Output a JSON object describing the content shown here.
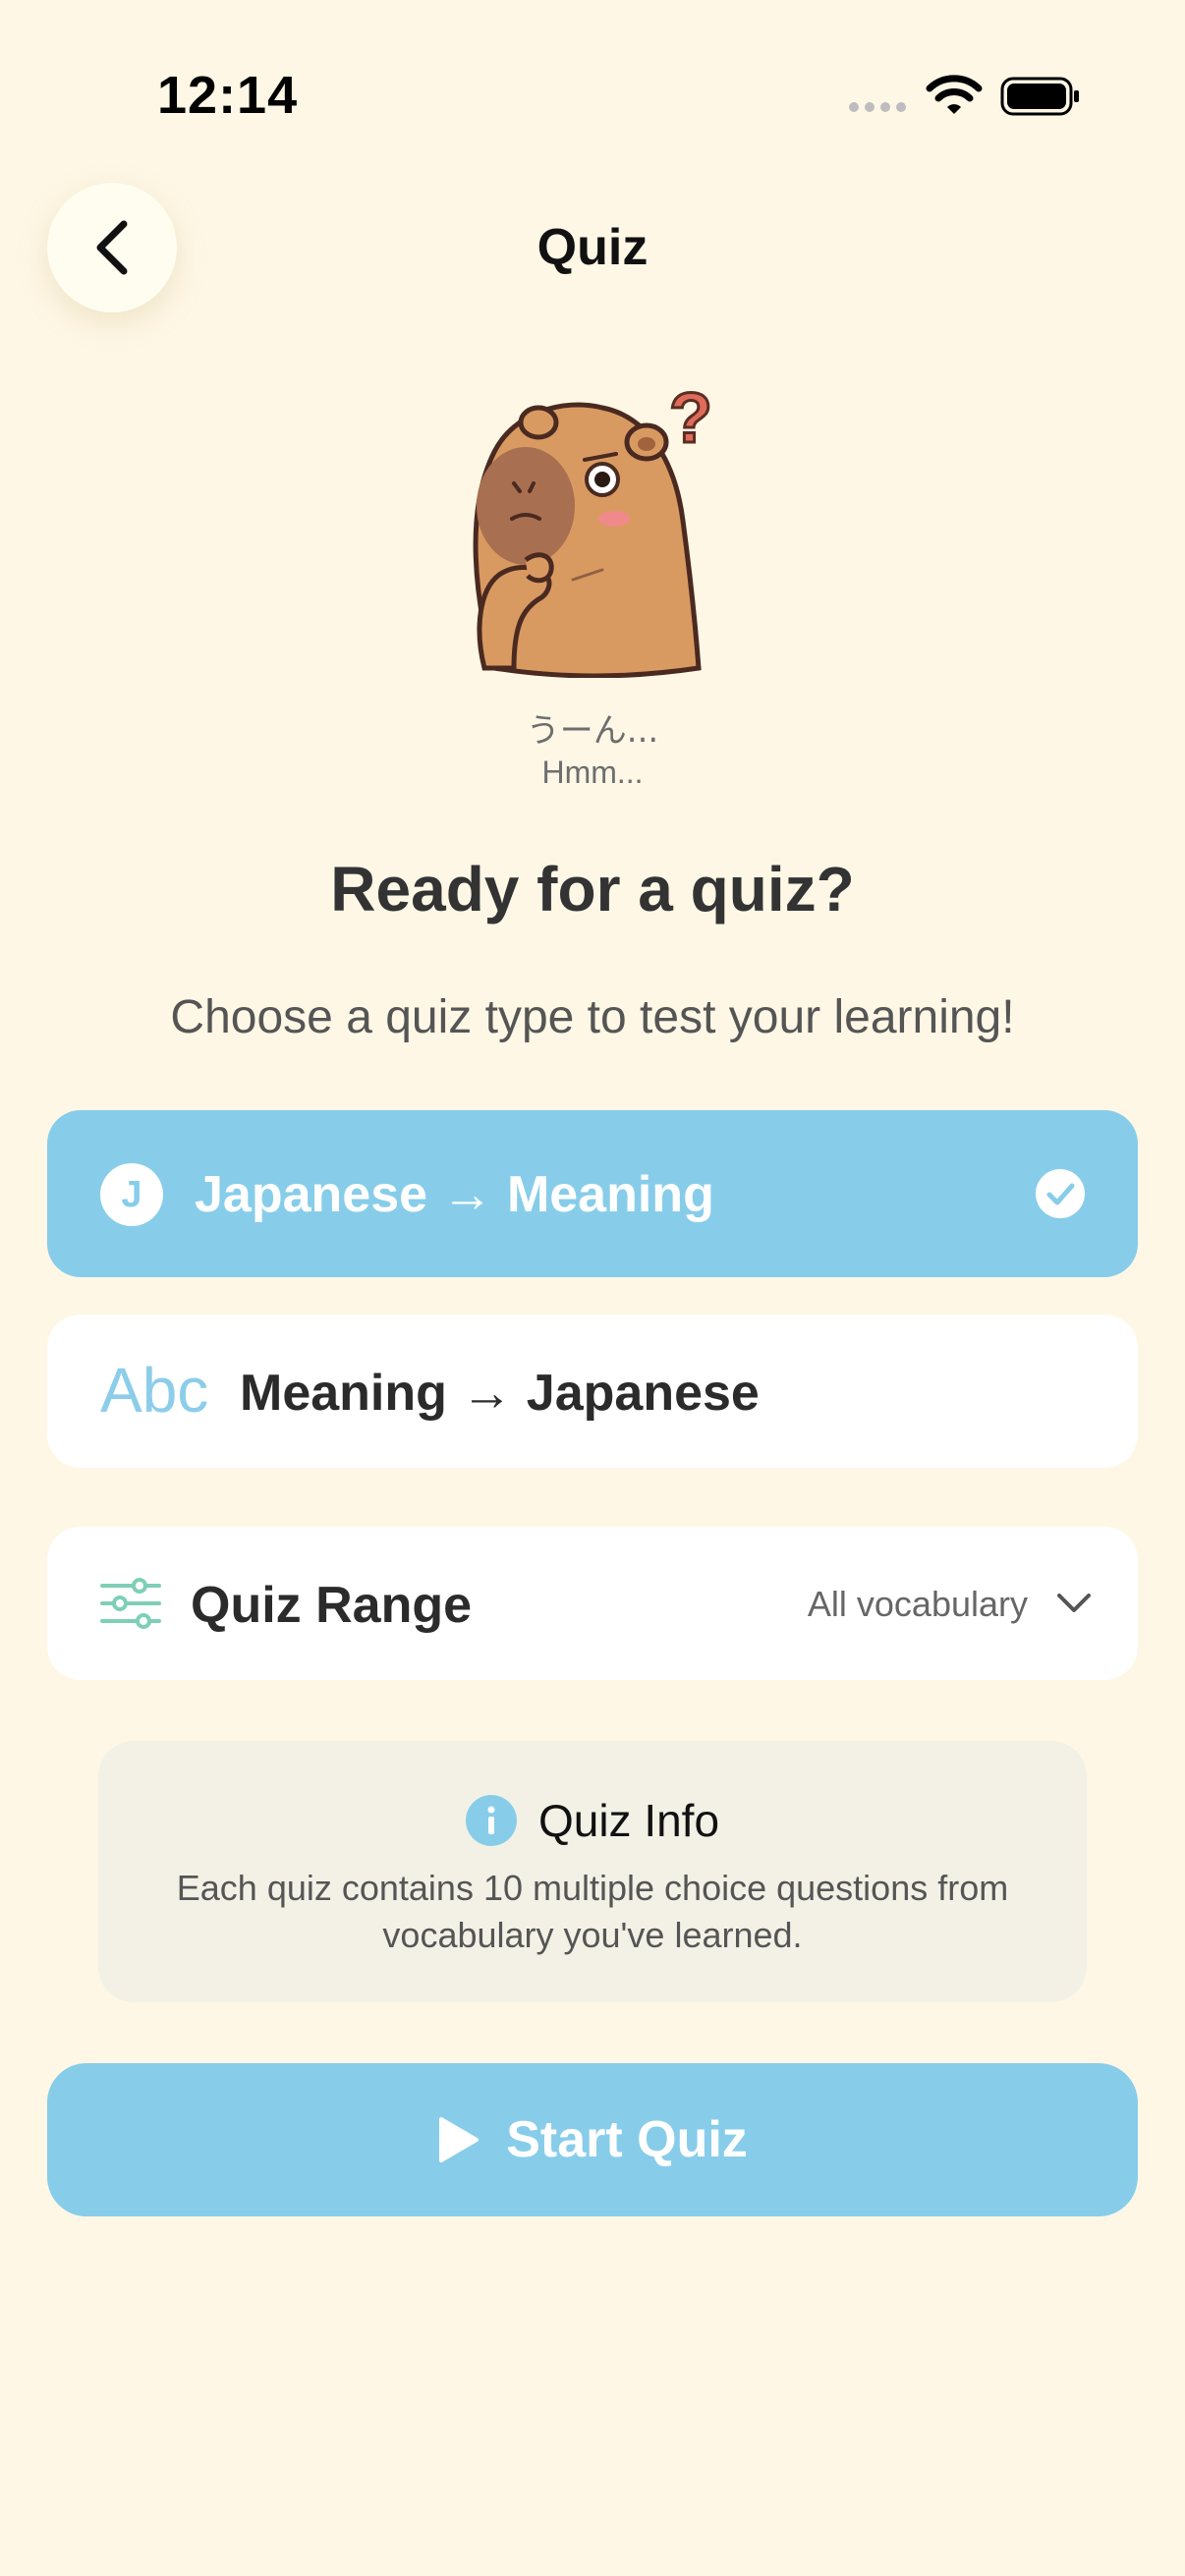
{
  "status_bar": {
    "time": "12:14"
  },
  "header": {
    "title": "Quiz"
  },
  "mascot": {
    "caption_jp": "うーん...",
    "caption_en": "Hmm..."
  },
  "main": {
    "headline": "Ready for a quiz?",
    "subheadline": "Choose a quiz type to test your learning!"
  },
  "quiz_types": [
    {
      "badge": "J",
      "label": "Japanese → Meaning",
      "selected": true
    },
    {
      "badge": "Abc",
      "label": "Meaning → Japanese",
      "selected": false
    }
  ],
  "quiz_range": {
    "label": "Quiz Range",
    "value": "All vocabulary"
  },
  "info": {
    "title": "Quiz Info",
    "text": "Each quiz contains 10 multiple choice questions from vocabulary you've learned."
  },
  "start_button": {
    "label": "Start Quiz"
  },
  "colors": {
    "background": "#FEF7E6",
    "accent": "#87CDEA",
    "card": "#FFFFFF",
    "info_card": "#F3F1E6"
  }
}
